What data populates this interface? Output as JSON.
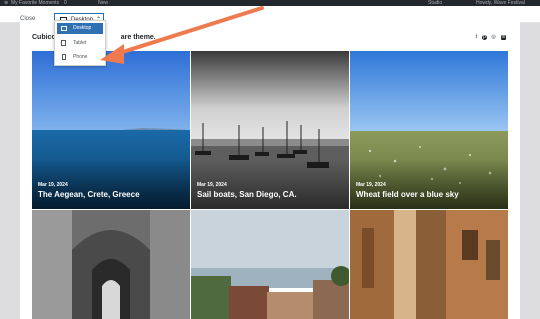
{
  "adminbar": {
    "site": "My Favorite Moments",
    "comments": "0",
    "new": "New",
    "right_a": "Studio",
    "right_b": "Howdy, Wave Festival"
  },
  "toolbar": {
    "close_label": "Close",
    "device_label": "Desktop",
    "device_menu": [
      {
        "label": "Desktop",
        "icon": "desktop-icon"
      },
      {
        "label": "Tablet",
        "icon": "tablet-icon"
      },
      {
        "label": "Phone",
        "icon": "phone-icon"
      }
    ]
  },
  "site": {
    "title_start": "Cubico",
    "title_end": "are theme.",
    "social": [
      "t",
      "p",
      "i",
      "in"
    ]
  },
  "annotation": {
    "arrow_color": "#f07a4f"
  },
  "gallery": [
    {
      "date": "Mar 19, 2024",
      "caption": "The Aegean, Crete, Greece"
    },
    {
      "date": "Mar 19, 2024",
      "caption": "Sail boats, San Diego, CA."
    },
    {
      "date": "Mar 19, 2024",
      "caption": "Wheat field over a blue sky"
    },
    {
      "date": "",
      "caption": ""
    },
    {
      "date": "",
      "caption": ""
    },
    {
      "date": "",
      "caption": ""
    }
  ]
}
